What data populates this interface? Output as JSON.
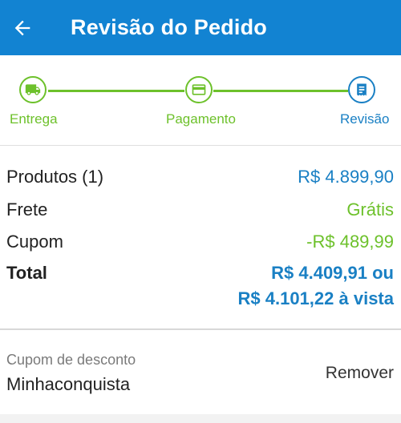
{
  "appbar": {
    "title": "Revisão do Pedido"
  },
  "stepper": {
    "steps": [
      {
        "label": "Entrega",
        "icon": "truck-icon"
      },
      {
        "label": "Pagamento",
        "icon": "credit-card-icon"
      },
      {
        "label": "Revisão",
        "icon": "receipt-icon"
      }
    ],
    "colors": {
      "completed": "#6dc12b",
      "current": "#1a80c4"
    }
  },
  "summary": {
    "produtos_label": "Produtos (1)",
    "produtos_value": "R$ 4.899,90",
    "frete_label": "Frete",
    "frete_value": "Grátis",
    "cupom_label": "Cupom",
    "cupom_value": "-R$ 489,99",
    "total_label": "Total",
    "total_value_line1": "R$ 4.409,91 ou",
    "total_value_line2": "R$ 4.101,22 à vista"
  },
  "coupon": {
    "caption": "Cupom de desconto",
    "code": "Minhaconquista",
    "remove_label": "Remover"
  },
  "colors": {
    "appbar": "#1283d2",
    "accent_blue": "#1a80c4",
    "accent_green": "#6dc12b"
  }
}
